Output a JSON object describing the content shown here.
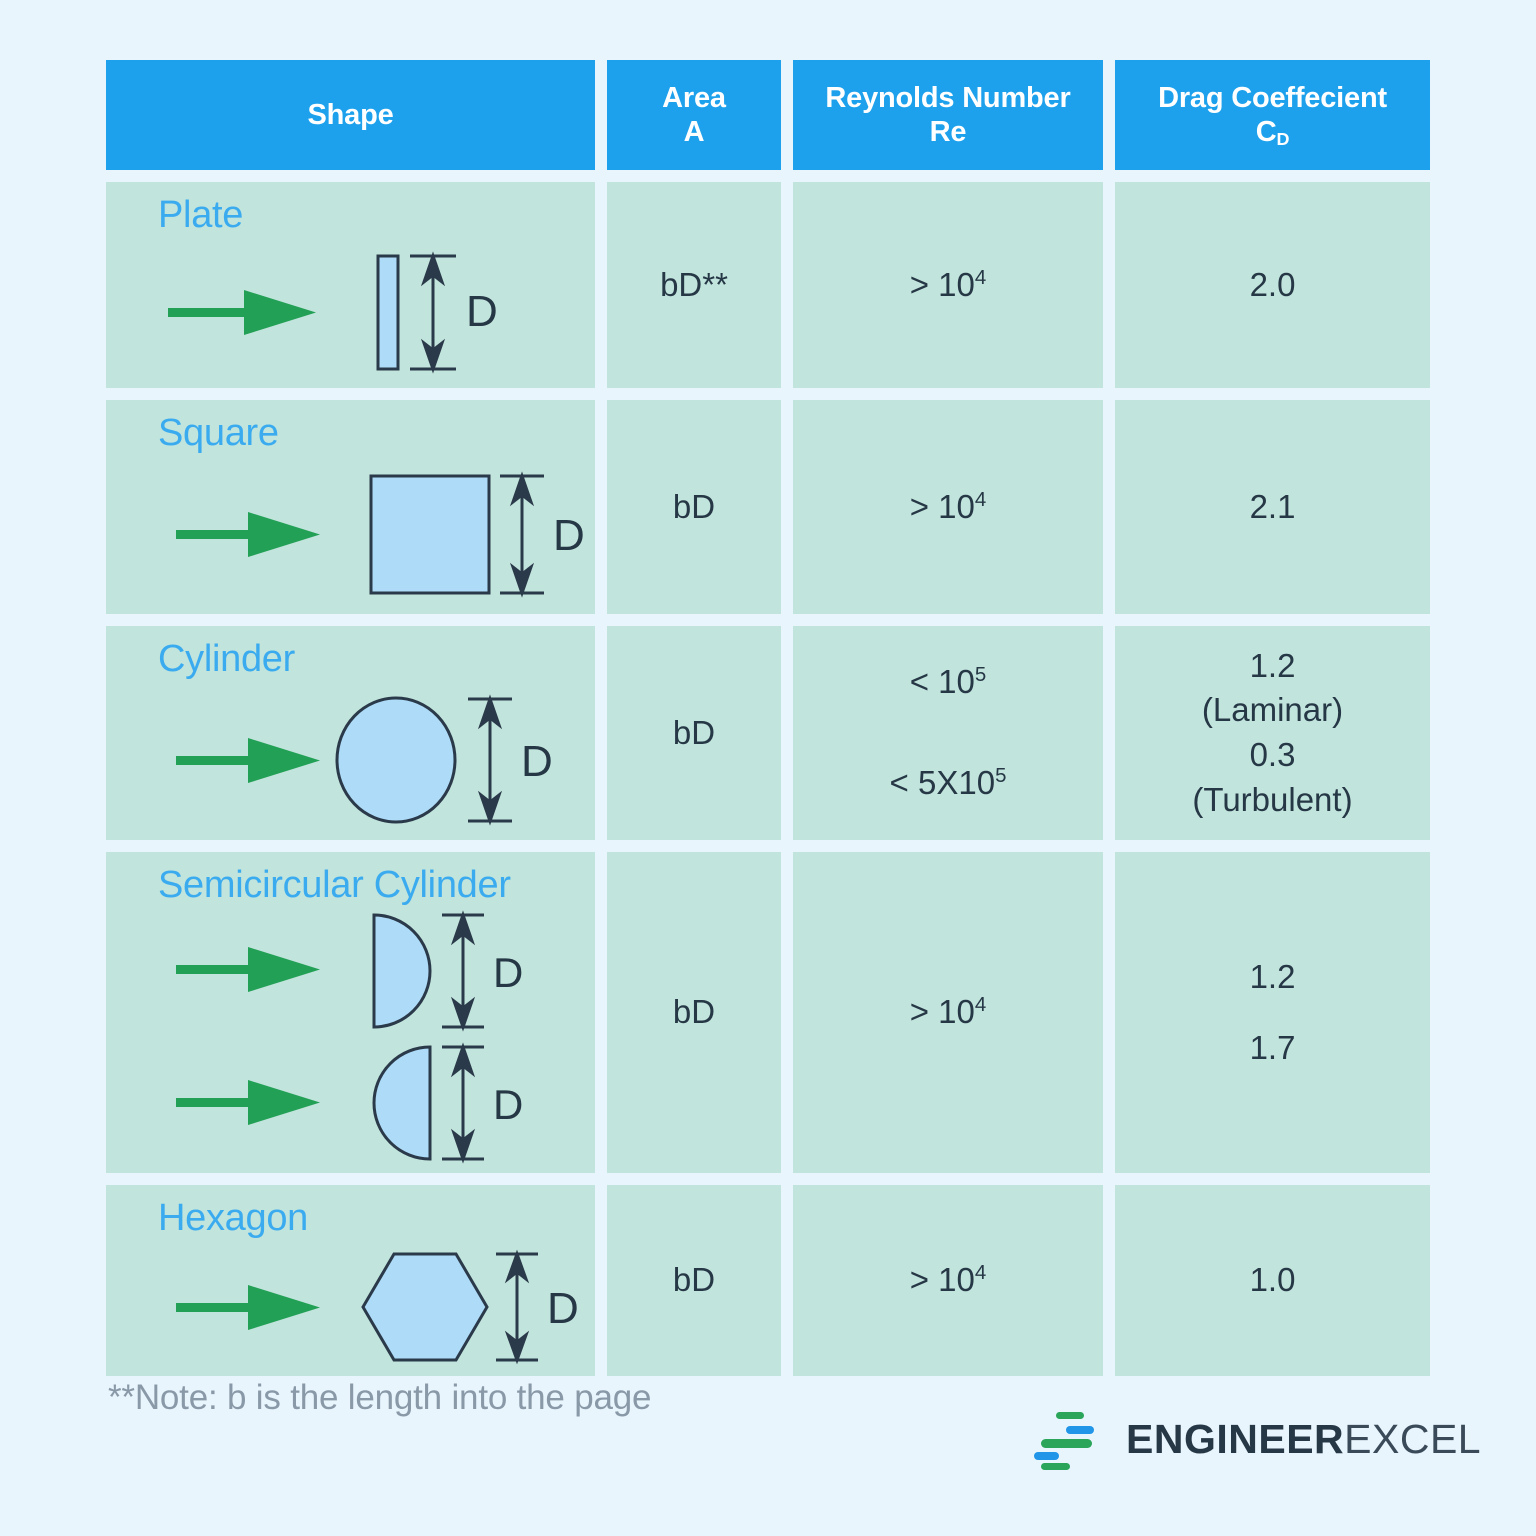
{
  "colors": {
    "page_background": "#e8f5fd",
    "header_blue": "#1da1ec",
    "cell_green": "#c1e4dc",
    "label_blue": "#3babf0",
    "shape_fill": "#aedcf8",
    "shape_stroke": "#2b3a4a",
    "arrow_green": "#22a055",
    "text_dark": "#263746",
    "note_gray": "#8a99a8"
  },
  "table": {
    "headers": [
      {
        "line1": "Shape",
        "line2": ""
      },
      {
        "line1": "Area",
        "line2": "A"
      },
      {
        "line1": "Reynolds Number",
        "line2": "Re"
      },
      {
        "line1": "Drag Coeffecient",
        "line2": "C",
        "line2_sub": "D"
      }
    ],
    "rows": [
      {
        "shape_label": "Plate",
        "shape_icon": "plate-shape",
        "dimension_label": "D",
        "flow_arrow": "flow-arrow-icon",
        "area": "bD**",
        "reynolds": [
          {
            "prefix": "> 10",
            "exponent": "4"
          }
        ],
        "drag_coefficient": [
          {
            "value": "2.0",
            "regime": ""
          }
        ]
      },
      {
        "shape_label": "Square",
        "shape_icon": "square-shape",
        "dimension_label": "D",
        "flow_arrow": "flow-arrow-icon",
        "area": "bD",
        "reynolds": [
          {
            "prefix": "> 10",
            "exponent": "4"
          }
        ],
        "drag_coefficient": [
          {
            "value": "2.1",
            "regime": ""
          }
        ]
      },
      {
        "shape_label": "Cylinder",
        "shape_icon": "circle-shape",
        "dimension_label": "D",
        "flow_arrow": "flow-arrow-icon",
        "area": "bD",
        "reynolds": [
          {
            "prefix": "< 10",
            "exponent": "5"
          },
          {
            "prefix": "< 5X10",
            "exponent": "5"
          }
        ],
        "drag_coefficient": [
          {
            "value": "1.2",
            "regime": "(Laminar)"
          },
          {
            "value": "0.3",
            "regime": "(Turbulent)"
          }
        ]
      },
      {
        "shape_label": "Semicircular Cylinder",
        "shape_icon": "semicircle-shape",
        "dimension_label": "D",
        "flow_arrow": "flow-arrow-icon",
        "area": "bD",
        "reynolds": [
          {
            "prefix": "> 10",
            "exponent": "4"
          }
        ],
        "drag_coefficient": [
          {
            "value": "1.2",
            "regime": ""
          },
          {
            "value": "1.7",
            "regime": ""
          }
        ]
      },
      {
        "shape_label": "Hexagon",
        "shape_icon": "hexagon-shape",
        "dimension_label": "D",
        "flow_arrow": "flow-arrow-icon",
        "area": "bD",
        "reynolds": [
          {
            "prefix": "> 10",
            "exponent": "4"
          }
        ],
        "drag_coefficient": [
          {
            "value": "1.0",
            "regime": ""
          }
        ]
      }
    ]
  },
  "footer": {
    "note": "**Note: b is the length into the page",
    "logo": {
      "mark": "engineerexcel-dashes-logo",
      "bold_part": "ENGINEER",
      "light_part": "EXCEL"
    }
  }
}
